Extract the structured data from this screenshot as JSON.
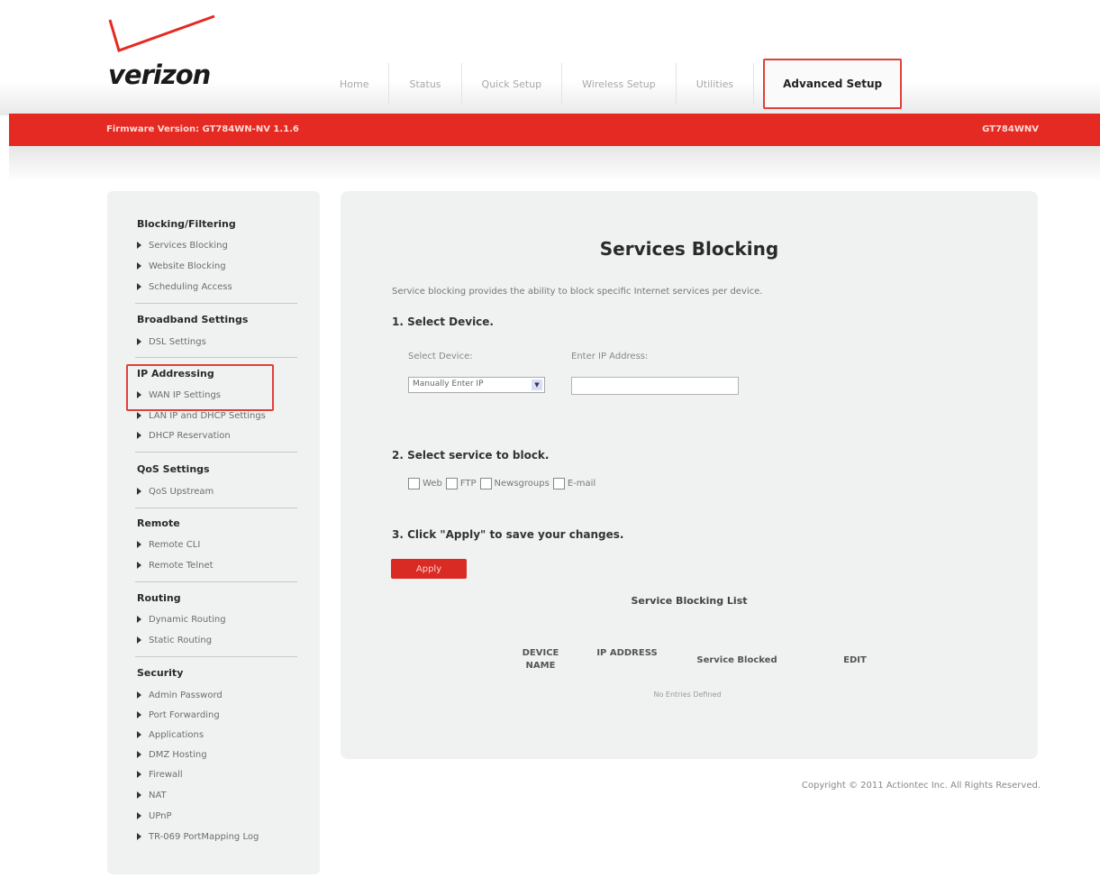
{
  "brand": {
    "logo_text": "verizon",
    "accent_color": "#e42a22"
  },
  "nav": {
    "tabs": [
      {
        "label": "Home"
      },
      {
        "label": "Status"
      },
      {
        "label": "Quick Setup"
      },
      {
        "label": "Wireless Setup"
      },
      {
        "label": "Utilities"
      },
      {
        "label": "Advanced Setup",
        "active": true
      }
    ]
  },
  "banner": {
    "firmware": "Firmware Version: GT784WN-NV 1.1.6",
    "model": "GT784WNV"
  },
  "sidebar": {
    "sections": [
      {
        "title": "Blocking/Filtering",
        "items": [
          "Services Blocking",
          "Website Blocking",
          "Scheduling Access"
        ]
      },
      {
        "title": "Broadband Settings",
        "items": [
          "DSL Settings"
        ]
      },
      {
        "title": "IP Addressing",
        "items": [
          "WAN IP Settings",
          "LAN IP and DHCP Settings",
          "DHCP Reservation"
        ]
      },
      {
        "title": "QoS Settings",
        "items": [
          "QoS Upstream"
        ]
      },
      {
        "title": "Remote",
        "items": [
          "Remote CLI",
          "Remote Telnet"
        ]
      },
      {
        "title": "Routing",
        "items": [
          "Dynamic Routing",
          "Static Routing"
        ]
      },
      {
        "title": "Security",
        "items": [
          "Admin Password",
          "Port Forwarding",
          "Applications",
          "DMZ Hosting",
          "Firewall",
          "NAT",
          "UPnP",
          "TR-069 PortMapping Log"
        ]
      }
    ]
  },
  "main": {
    "title": "Services Blocking",
    "intro": "Service blocking provides the ability to block specific Internet services per device.",
    "step1": "1. Select Device.",
    "select_device_label": "Select Device:",
    "ip_label": "Enter IP Address:",
    "select_device_value": "Manually Enter IP",
    "ip_value": "",
    "step2": "2. Select service to block.",
    "services": [
      "Web",
      "FTP",
      "Newsgroups",
      "E-mail"
    ],
    "step3": "3. Click \"Apply\" to save your changes.",
    "apply_label": "Apply",
    "list_title": "Service Blocking List",
    "columns": {
      "device_name": "DEVICE NAME",
      "ip_address": "IP ADDRESS",
      "service_blocked": "Service Blocked",
      "edit": "EDIT"
    },
    "empty_message": "No Entries Defined"
  },
  "footer": {
    "copyright": "Copyright © 2011 Actiontec Inc. All Rights Reserved."
  }
}
